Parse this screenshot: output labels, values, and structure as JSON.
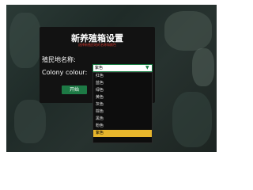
{
  "dialog": {
    "title": "新养殖箱设置",
    "subtitle": "选择新殖民地的名称和颜色"
  },
  "form": {
    "colony_name_label": "殖民地名称:",
    "colony_name_value": "",
    "colony_colour_label": "Colony colour:",
    "colony_colour_selected": "紫色",
    "start_label": "开始"
  },
  "dropdown": {
    "options": [
      "红色",
      "蓝色",
      "绿色",
      "黄色",
      "灰色",
      "棕色",
      "黑色",
      "粉色",
      "紫色"
    ],
    "selected_index": 8
  },
  "colors": {
    "accent_green": "#1d7a45",
    "highlight": "#e7b62c",
    "warning_red": "#d2372d"
  },
  "icons": {
    "select_chevron": "chevron-down-icon"
  }
}
